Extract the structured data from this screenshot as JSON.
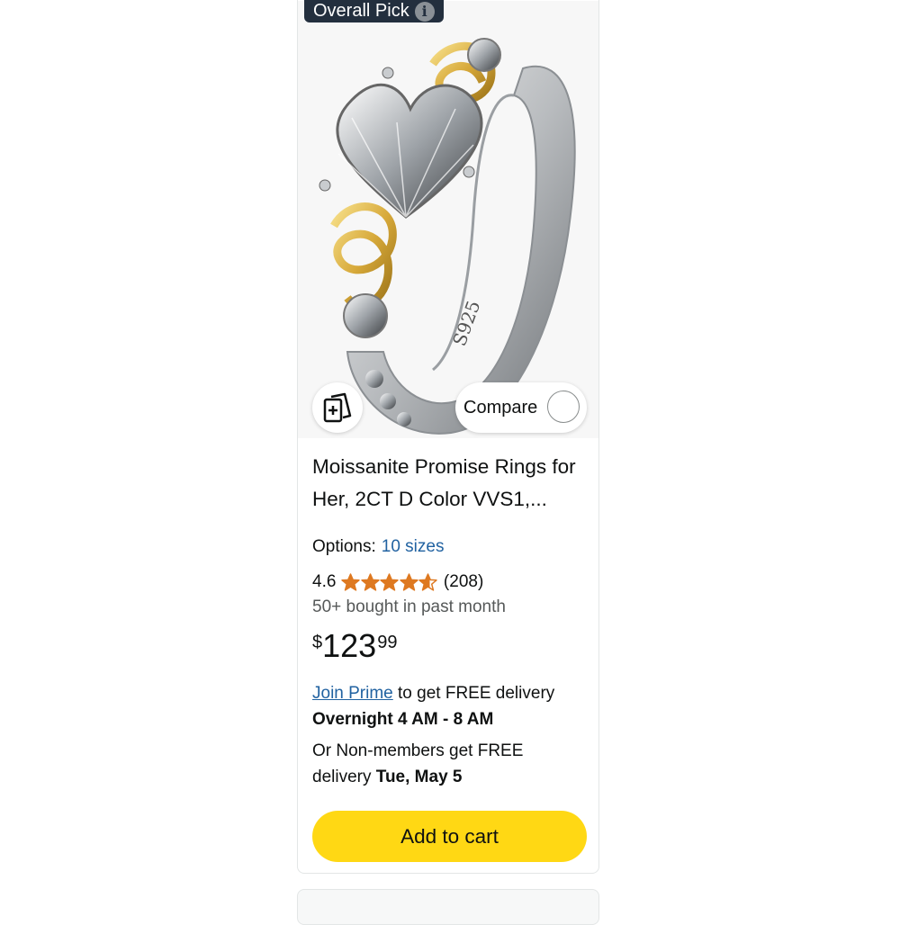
{
  "badge": {
    "label": "Overall Pick",
    "icon": "info-icon"
  },
  "product": {
    "image_alt": "Heart moissanite ring with gold Celtic knots",
    "band_engraving": "S925",
    "add_to_list_icon": "add-to-list-icon",
    "compare_label": "Compare",
    "title": "Moissanite Promise Rings for Her, 2CT D Color VVS1,...",
    "options_label": "Options:",
    "options_value": "10 sizes",
    "rating": 4.6,
    "rating_text": "4.6",
    "review_count": "(208)",
    "bought": "50+ bought in past month",
    "price": {
      "symbol": "$",
      "whole": "123",
      "fraction": "99"
    },
    "delivery": {
      "prime_link": "Join Prime",
      "prime_rest": " to get FREE delivery",
      "prime_time": "Overnight 4 AM - 8 AM",
      "nonmember_text": "Or Non-members get FREE delivery ",
      "nonmember_date": "Tue, May 5"
    },
    "cart_button": "Add to cart"
  },
  "colors": {
    "star": "#de7921",
    "link": "#2162a1",
    "cart": "#ffd814",
    "badge": "#232f3e"
  }
}
